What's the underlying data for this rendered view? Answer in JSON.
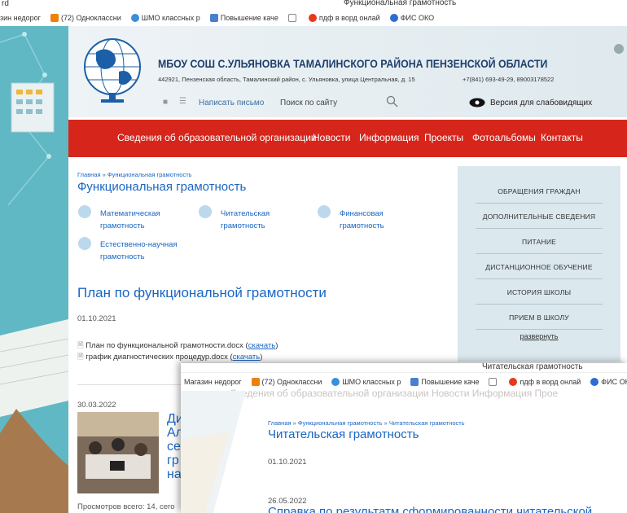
{
  "titlebar": {
    "left": "rd",
    "title": "Функциональная грамотность"
  },
  "bookmarks": [
    {
      "label": "зин недорог",
      "color": ""
    },
    {
      "label": "(72) Одноклассни",
      "color": "#ee8208"
    },
    {
      "label": "ШМО классных р",
      "color": "#3b8fd8"
    },
    {
      "label": "Повышение каче",
      "color": "#4a7fd0"
    },
    {
      "label": "",
      "color": "#888"
    },
    {
      "label": "пдф в ворд онлай",
      "color": "#e8381c"
    },
    {
      "label": "ФИС ОКО",
      "color": "#2d6cd3"
    }
  ],
  "header": {
    "school": "МБОУ СОШ С.УЛЬЯНОВКА ТАМАЛИНСКОГО РАЙОНА ПЕНЗЕНСКОЙ ОБЛАСТИ",
    "address": "442921, Пензенская область, Тамалинский район, с. Ульяновка, улица Центральная, д. 15",
    "phone": "+7(841) 693-49-29, 89003178522",
    "write": "Написать письмо",
    "search": "Поиск по сайту",
    "vision": "Версия для слабовидящих"
  },
  "nav": [
    "Сведения об образовательной организации",
    "Новости",
    "Информация",
    "Проекты",
    "Фотоальбомы",
    "Контакты"
  ],
  "breadcrumb": "Главная » Функциональная грамотность",
  "page_title": "Функциональная грамотность",
  "literacy_links": [
    {
      "l1": "Математическая",
      "l2": "грамотность"
    },
    {
      "l1": "Читательская",
      "l2": "грамотность"
    },
    {
      "l1": "Финансовая",
      "l2": "грамотность"
    },
    {
      "l1": "Естественно-научная",
      "l2": "грамотность"
    }
  ],
  "article1": {
    "title": "План по функциональной грамотности",
    "date": "01.10.2021",
    "files": [
      {
        "name": "План по функциональной грамотности.docx",
        "link": "скачать"
      },
      {
        "name": "график диагностических процедур.docx",
        "link": "скачать"
      }
    ]
  },
  "article2": {
    "date": "30.03.2022",
    "title_lines": [
      "Ди",
      "Ал",
      "се",
      "гр",
      "на"
    ],
    "views": "Просмотров всего: 14, сего"
  },
  "sidebar": {
    "items": [
      "ОБРАЩЕНИЯ ГРАЖДАН",
      "ДОПОЛНИТЕЛЬНЫЕ СВЕДЕНИЯ",
      "ПИТАНИЕ",
      "ДИСТАНЦИОННОЕ ОБУЧЕНИЕ",
      "ИСТОРИЯ ШКОЛЫ",
      "ПРИЕМ В ШКОЛУ"
    ],
    "expand": "развернуть"
  },
  "popup": {
    "title": "Читательская грамотность",
    "bookmarks": [
      "Магазин недорог",
      "(72) Одноклассни",
      "ШМО классных р",
      "Повышение каче",
      "",
      "пдф в ворд онлай",
      "ФИС ОКО"
    ],
    "nav_ghost": "Сведения об образовательной организации   Новости   Информация   Прое",
    "breadcrumb": "Главная » Функциональная грамотность » Читательская грамотность",
    "heading": "Читательская грамотность",
    "date1": "01.10.2021",
    "date2": "26.05.2022",
    "teaser": "Справка по результатм сформированности читательской"
  }
}
